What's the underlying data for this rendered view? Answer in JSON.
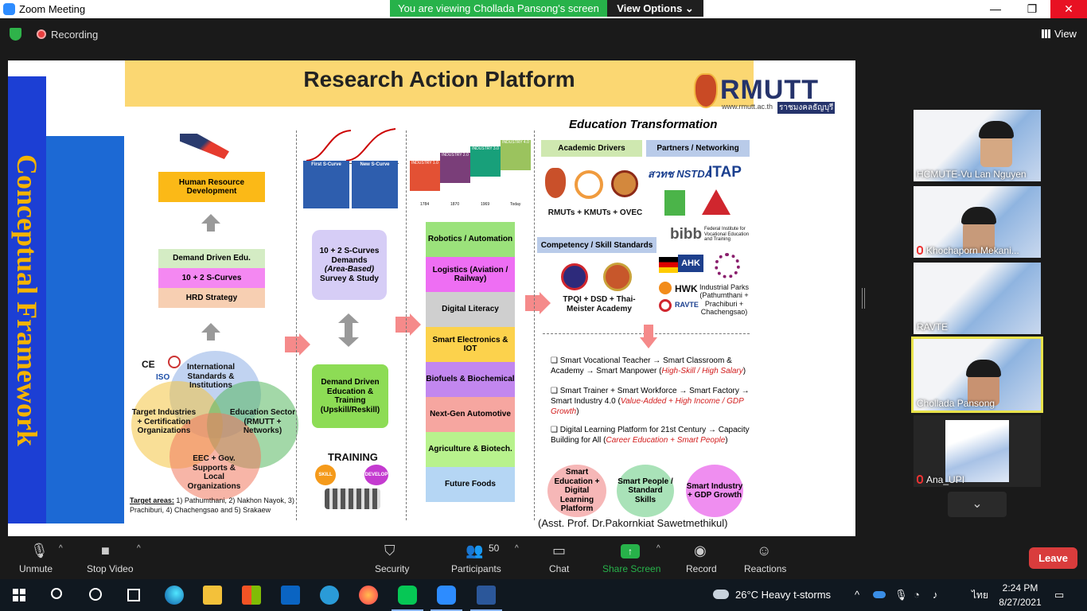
{
  "window": {
    "title": "Zoom Meeting",
    "banner": "You are viewing Chollada Pansong's screen",
    "view_options": "View Options ⌄",
    "min": "—",
    "max": "❐",
    "close": "✕"
  },
  "top": {
    "recording": "Recording",
    "view": "View"
  },
  "slide": {
    "side_title": "Conceptual Framework",
    "title": "Research Action Platform",
    "logo": {
      "name": "RMUTT",
      "url": "www.rmutt.ac.th",
      "thai": "ราชมงคลธัญบุรี"
    },
    "col1": {
      "hrd": "Human Resource Development",
      "stack": [
        "Demand Driven Edu.",
        "10 + 2 S-Curves",
        "HRD Strategy"
      ],
      "marks": {
        "ce": "CE",
        "iso": "ISO"
      },
      "circles": [
        "International Standards & Institutions",
        "Target Industries + Certification Organizations",
        "Education Sector (RMUTT + Networks)",
        "EEC + Gov. Supports & Local Organizations"
      ],
      "target_label": "Target areas:",
      "target_text": " 1) Pathumthani, 2) Nakhon Nayok, 3) Prachiburi, 4) Chachengsao and 5) Srakaew"
    },
    "col2": {
      "curves": {
        "first": "First S-Curve",
        "new": "New S-Curve"
      },
      "demands_line1": "10 + 2 S-Curves Demands",
      "demands_line2": "(Area-Based)",
      "demands_line3": "Survey & Study",
      "demand_driven": "Demand Driven Education & Training (Upskill/Reskill)",
      "training": "TRAINING",
      "skill": "SKILL",
      "develop": "DEVELOP"
    },
    "col3": {
      "industry": [
        "INDUSTRY 1.0",
        "INDUSTRY 2.0",
        "INDUSTRY 3.0",
        "INDUSTRY 4.0"
      ],
      "years": [
        "1784",
        "1870",
        "1969",
        "Today"
      ],
      "sectors": [
        "Robotics / Automation",
        "Logistics (Aviation / Railway)",
        "Digital Literacy",
        "Smart Electronics & IOT",
        "Biofuels & Biochemical",
        "Next-Gen Automotive",
        "Agriculture & Biotech.",
        "Future Foods"
      ]
    },
    "col4": {
      "heading": "Education Transformation",
      "academic": "Academic Drivers",
      "partners": "Partners / Networking",
      "rmuts": "RMUTs + KMUTs + OVEC",
      "competency": "Competency / Skill Standards",
      "tpqi": "TPQI + DSD + Thai-Meister Academy",
      "nstda": "สวทช NSTDA",
      "itap": "ITAP",
      "bibb": "bibb",
      "bibb_sub": "Federal Institute for Vocational Education and Training",
      "ahk": "AHK",
      "hwk": "HWK",
      "ravte": "RAVTE",
      "parks": "Industrial Parks (Pathumthani + Prachiburi + Chachengsao)",
      "bullets": [
        {
          "text": "❑ Smart Vocational Teacher → Smart Classroom & Academy → Smart Manpower (",
          "red": "High-Skill / High Salary",
          "end": ")"
        },
        {
          "text": "❑ Smart Trainer + Smart Workforce → Smart Factory → Smart Industry 4.0 (",
          "red": "Value-Added + High Income / GDP Growth",
          "end": ")"
        },
        {
          "text": "❑ Digital Learning Platform for 21st Century → Capacity Building for All (",
          "red": "Career Education + Smart People",
          "end": ")"
        }
      ],
      "smart": [
        "Smart Education + Digital Learning Platform",
        "Smart People / Standard Skills",
        "Smart Industry + GDP Growth"
      ],
      "credit": "(Asst. Prof. Dr.Pakornkiat Sawetmethikul)"
    }
  },
  "participants": [
    {
      "name": "HCMUTE-Vu Lan Nguyen"
    },
    {
      "name": "Khochaporn Mekani..."
    },
    {
      "name": "RAVTE"
    },
    {
      "name": "Chollada Pansong"
    },
    {
      "name": "Ana_UPI"
    }
  ],
  "toolbar": {
    "unmute": "Unmute",
    "stop_video": "Stop Video",
    "security": "Security",
    "participants": "Participants",
    "participants_count": "50",
    "chat": "Chat",
    "share": "Share Screen",
    "record": "Record",
    "reactions": "Reactions",
    "leave": "Leave"
  },
  "taskbar": {
    "weather": "26°C  Heavy t-storms",
    "lang": "ไทย",
    "time": "2:24 PM",
    "date": "8/27/2021"
  },
  "colors": {
    "zoom_green": "#27b24a",
    "leave_red": "#d93c3c",
    "slide_blue": "#1c3fd4",
    "title_yellow": "#fbd772"
  }
}
